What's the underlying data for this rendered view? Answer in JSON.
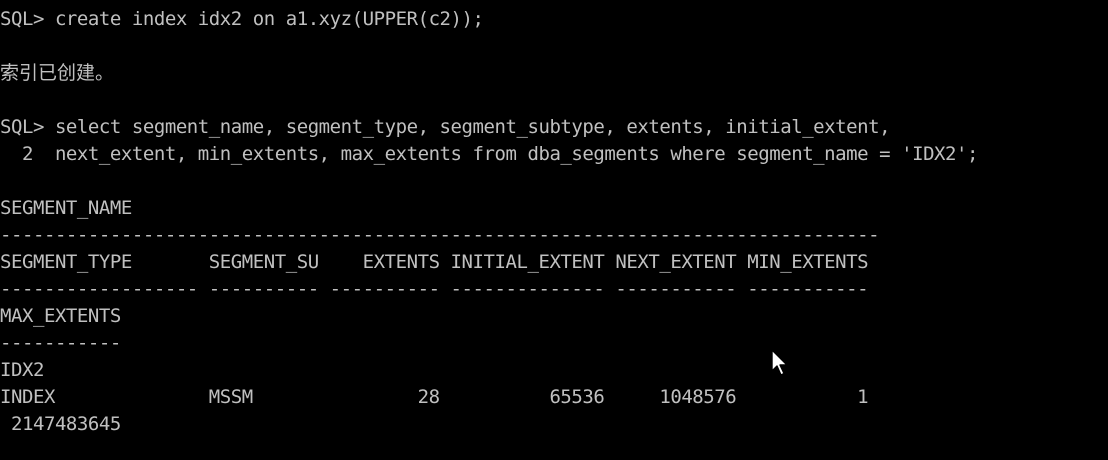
{
  "console": {
    "lines": [
      "SQL> create index idx2 on a1.xyz(UPPER(c2));",
      "",
      "索引已创建。",
      "",
      "SQL> select segment_name, segment_type, segment_subtype, extents, initial_extent,",
      "  2  next_extent, min_extents, max_extents from dba_segments where segment_name = 'IDX2';",
      "",
      "SEGMENT_NAME",
      "--------------------------------------------------------------------------------",
      "SEGMENT_TYPE       SEGMENT_SU    EXTENTS INITIAL_EXTENT NEXT_EXTENT MIN_EXTENTS",
      "------------------ ---------- ---------- -------------- ----------- -----------",
      "MAX_EXTENTS",
      "-----------",
      "IDX2",
      "INDEX              MSSM               28          65536     1048576           1",
      " 2147483645"
    ]
  },
  "colors": {
    "background": "#000000",
    "text": "#c0c0c0",
    "cursor_fill": "#ffffff",
    "cursor_outline": "#000000"
  },
  "icons": {
    "pointer": "mouse-pointer-icon"
  }
}
